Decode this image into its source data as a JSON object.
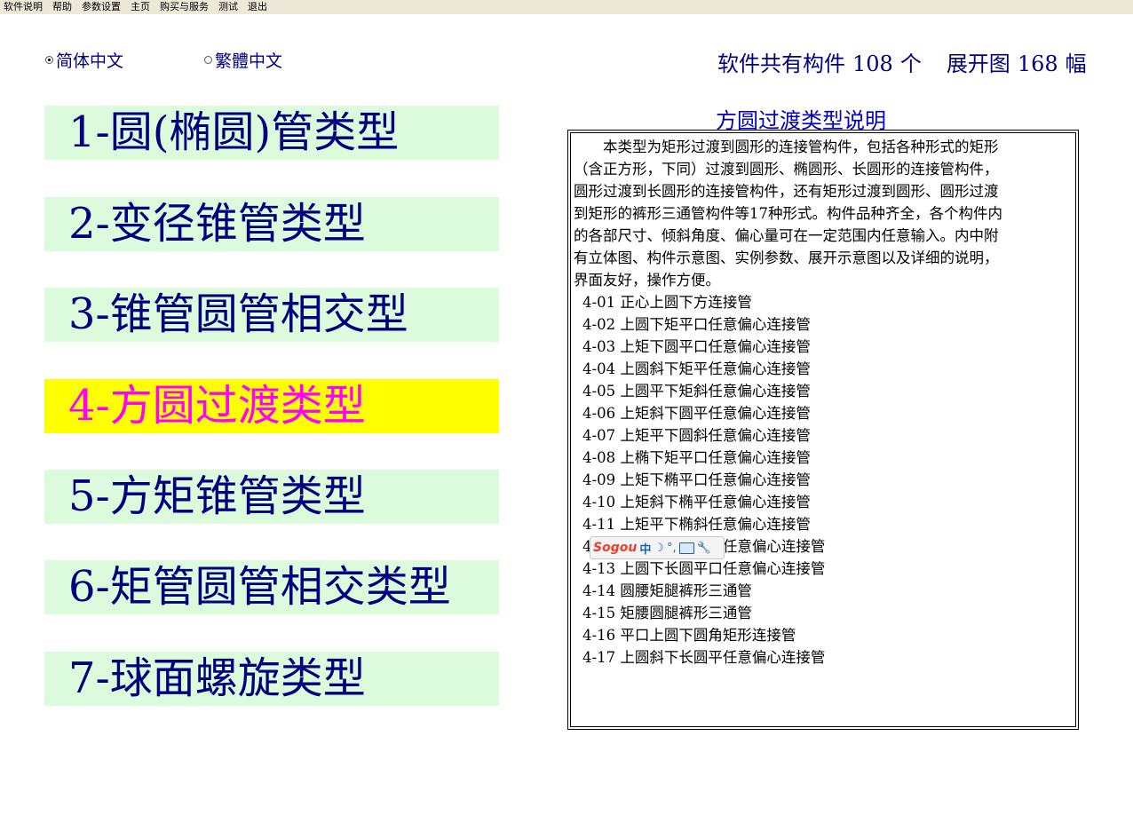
{
  "menu": [
    "软件说明",
    "帮助",
    "参数设置",
    "主页",
    "购买与服务",
    "测试",
    "退出"
  ],
  "language": {
    "simplified": "简体中文",
    "traditional": "繁體中文",
    "selected": "simplified"
  },
  "summary": {
    "label1": "软件共有构件",
    "count": "108",
    "unit1": "个",
    "label2": "展开图",
    "drawings": "168",
    "unit2": "幅"
  },
  "categories": [
    "1-圆(椭圆)管类型",
    "2-变径锥管类型",
    "3-锥管圆管相交型",
    "4-方圆过渡类型",
    "5-方矩锥管类型",
    "6-矩管圆管相交类型",
    "7-球面螺旋类型"
  ],
  "active_category_index": 3,
  "description": {
    "title": "方圆过渡类型说明",
    "intro_lines": [
      "本类型为矩形过渡到圆形的连接管构件，包括各种形式的矩形",
      "（含正方形，下同）过渡到圆形、椭圆形、长圆形的连接管构件，",
      "圆形过渡到长圆形的连接管构件，还有矩形过渡到圆形、圆形过渡",
      "到矩形的裤形三通管构件等17种形式。构件品种齐全，各个构件内",
      "的各部尺寸、倾斜角度、偏心量可在一定范围内任意输入。内中附",
      "有立体图、构件示意图、实例参数、展开示意图以及详细的说明，",
      "界面友好，操作方便。"
    ],
    "items": [
      "4-01  正心上圆下方连接管",
      "4-02  上圆下矩平口任意偏心连接管",
      "4-03  上矩下圆平口任意偏心连接管",
      "4-04  上圆斜下矩平任意偏心连接管",
      "4-05  上圆平下矩斜任意偏心连接管",
      "4-06  上矩斜下圆平任意偏心连接管",
      "4-07  上矩平下圆斜任意偏心连接管",
      "4-08  上椭下矩平口任意偏心连接管",
      "4-09  上矩下椭平口任意偏心连接管",
      "4-10  上矩斜下椭平任意偏心连接管",
      "4-11  上矩平下椭斜任意偏心连接管",
      "4-12  上长圆下矩平口任意偏心连接管",
      "4-13  上圆下长圆平口任意偏心连接管",
      "4-14  圆腰矩腿裤形三通管",
      "4-15  矩腰圆腿裤形三通管",
      "4-16  平口上圆下圆角矩形连接管",
      "4-17  上圆斜下长圆平任意偏心连接管"
    ]
  },
  "ime": {
    "logo": "Sogou",
    "mode": "中",
    "punct": "°,"
  }
}
